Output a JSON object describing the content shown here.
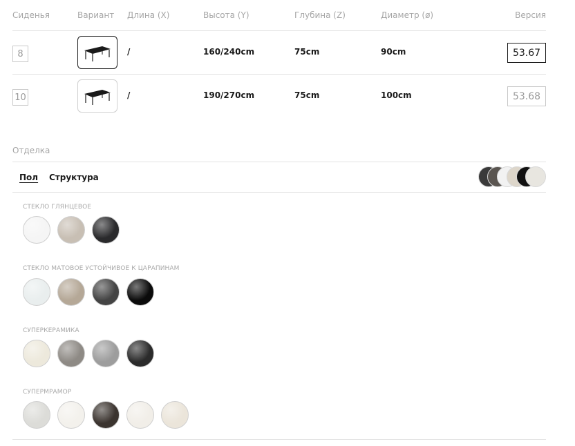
{
  "table": {
    "headers": {
      "seats": "Сиденья",
      "variant": "Вариант",
      "length": "Длина (X)",
      "height": "Высота (Y)",
      "depth": "Глубина (Z)",
      "diameter": "Диаметр (ø)",
      "version": "Версия"
    },
    "rows": [
      {
        "seats": "8",
        "length": "/",
        "height": "160/240cm",
        "depth": "75cm",
        "diameter": "90cm",
        "version": "53.67",
        "selected": true
      },
      {
        "seats": "10",
        "length": "/",
        "height": "190/270cm",
        "depth": "75cm",
        "diameter": "100cm",
        "version": "53.68",
        "selected": false
      }
    ]
  },
  "finish": {
    "title": "Отделка",
    "tabs": [
      {
        "label": "Пол",
        "active": true
      },
      {
        "label": "Структура",
        "active": false
      }
    ],
    "preview_colors": [
      "#3a3a3a",
      "#5a5550",
      "#f2f2f2",
      "#ddd6ca",
      "#111111",
      "#e8e6e0"
    ],
    "groups": [
      {
        "title": "СТЕКЛО ГЛЯНЦЕВОЕ",
        "swatches": [
          {
            "name": "white-gloss",
            "color": "#f5f5f5"
          },
          {
            "name": "taupe-gloss",
            "color": "#c8bfb4"
          },
          {
            "name": "black-gloss",
            "color": "#2a2a2c"
          }
        ]
      },
      {
        "title": "СТЕКЛО МАТОВОЕ УСТОЙЧИВОЕ К ЦАРАПИНАМ",
        "swatches": [
          {
            "name": "white-matt",
            "color": "#e9eeee"
          },
          {
            "name": "taupe-matt",
            "color": "#b5a897"
          },
          {
            "name": "anthracite-matt",
            "color": "#444444"
          },
          {
            "name": "black-matt",
            "color": "#0b0b0b"
          }
        ]
      },
      {
        "title": "СУПЕРКЕРАМИКА",
        "swatches": [
          {
            "name": "cream-ceramic",
            "color": "#ede9dc"
          },
          {
            "name": "grey-ceramic",
            "color": "#8e8a85"
          },
          {
            "name": "concrete-ceramic",
            "color": "#9d9d9d"
          },
          {
            "name": "dark-ceramic",
            "color": "#2b2b2b"
          }
        ]
      },
      {
        "title": "СУПЕРМРАМОР",
        "swatches": [
          {
            "name": "grey-marble",
            "color": "#dcdcd8"
          },
          {
            "name": "white-marble",
            "color": "#f3f1ec"
          },
          {
            "name": "black-marble",
            "color": "#3b342f"
          },
          {
            "name": "calacatta-marble",
            "color": "#f1eee8"
          },
          {
            "name": "cream-marble",
            "color": "#ebe5da"
          }
        ]
      }
    ]
  }
}
